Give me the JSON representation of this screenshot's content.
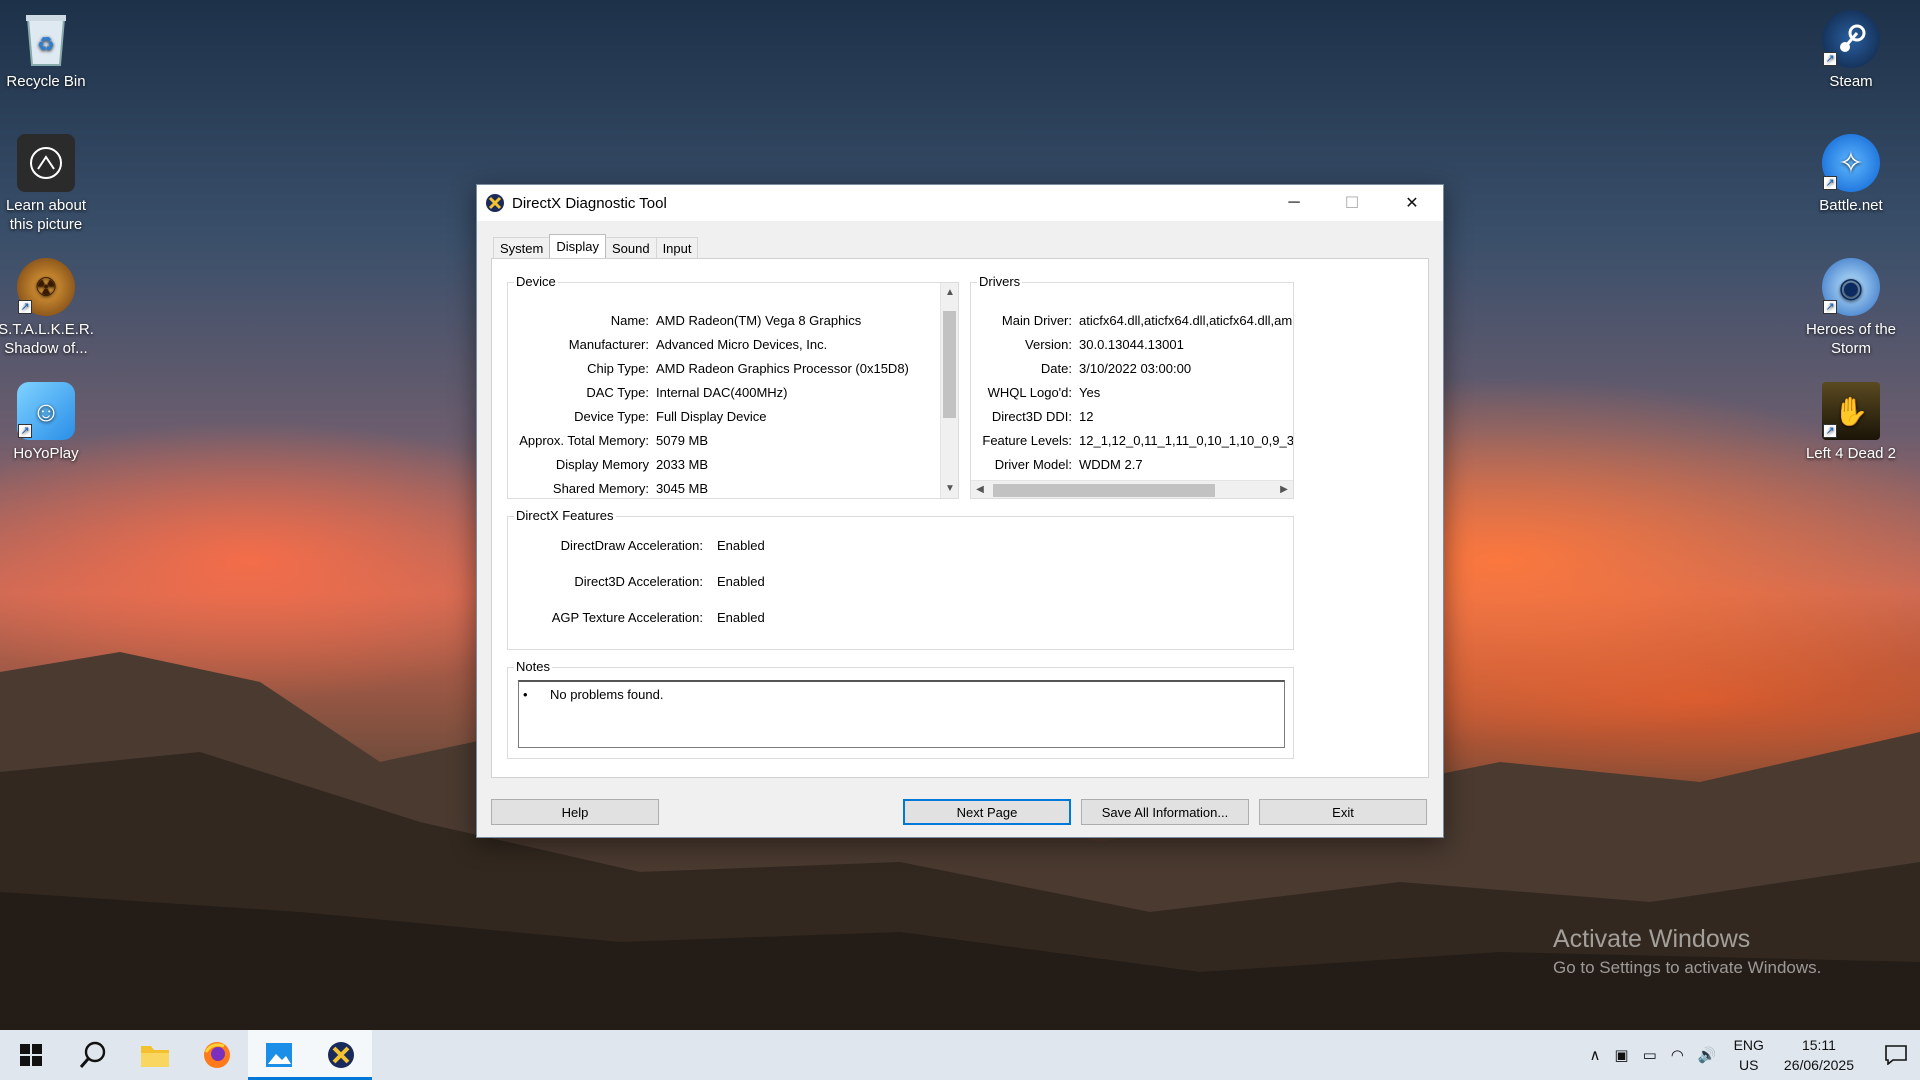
{
  "desktop": {
    "left_icons": [
      {
        "label": "Recycle Bin"
      },
      {
        "label": "Learn about this picture"
      },
      {
        "label": "S.T.A.L.K.E.R. Shadow of..."
      },
      {
        "label": "HoYoPlay"
      }
    ],
    "right_icons": [
      {
        "label": "Steam"
      },
      {
        "label": "Battle.net"
      },
      {
        "label": "Heroes of the Storm"
      },
      {
        "label": "Left 4 Dead 2"
      }
    ],
    "activation": {
      "line1": "Activate Windows",
      "line2": "Go to Settings to activate Windows."
    }
  },
  "window": {
    "title": "DirectX Diagnostic Tool",
    "controls": {
      "minimize": "─",
      "maximize": "☐",
      "close": "✕"
    },
    "tabs": [
      {
        "label": "System",
        "active": false
      },
      {
        "label": "Display",
        "active": true
      },
      {
        "label": "Sound",
        "active": false
      },
      {
        "label": "Input",
        "active": false
      }
    ],
    "device": {
      "label": "Device",
      "fields": [
        {
          "key": "Name:",
          "value": "AMD Radeon(TM) Vega 8 Graphics"
        },
        {
          "key": "Manufacturer:",
          "value": "Advanced Micro Devices, Inc."
        },
        {
          "key": "Chip Type:",
          "value": "AMD Radeon Graphics Processor (0x15D8)"
        },
        {
          "key": "DAC Type:",
          "value": "Internal DAC(400MHz)"
        },
        {
          "key": "Device Type:",
          "value": "Full Display Device"
        },
        {
          "key": "Approx. Total Memory:",
          "value": "5079 MB"
        },
        {
          "key": "Display Memory",
          "value": "2033 MB"
        },
        {
          "key": "Shared Memory:",
          "value": "3045 MB"
        }
      ]
    },
    "drivers": {
      "label": "Drivers",
      "fields": [
        {
          "key": "Main Driver:",
          "value": "aticfx64.dll,aticfx64.dll,aticfx64.dll,am"
        },
        {
          "key": "Version:",
          "value": "30.0.13044.13001"
        },
        {
          "key": "Date:",
          "value": "3/10/2022 03:00:00"
        },
        {
          "key": "WHQL Logo'd:",
          "value": "Yes"
        },
        {
          "key": "Direct3D DDI:",
          "value": "12"
        },
        {
          "key": "Feature Levels:",
          "value": "12_1,12_0,11_1,11_0,10_1,10_0,9_3"
        },
        {
          "key": "Driver Model:",
          "value": "WDDM 2.7"
        }
      ]
    },
    "features": {
      "label": "DirectX Features",
      "fields": [
        {
          "key": "DirectDraw Acceleration:",
          "value": "Enabled"
        },
        {
          "key": "Direct3D Acceleration:",
          "value": "Enabled"
        },
        {
          "key": "AGP Texture Acceleration:",
          "value": "Enabled"
        }
      ]
    },
    "notes": {
      "label": "Notes",
      "items": [
        "No problems found."
      ]
    },
    "buttons": {
      "help": "Help",
      "next": "Next Page",
      "save": "Save All Information...",
      "exit": "Exit"
    }
  },
  "taskbar": {
    "language": {
      "line1": "ENG",
      "line2": "US"
    },
    "clock": {
      "time": "15:11",
      "date": "26/06/2025"
    }
  }
}
